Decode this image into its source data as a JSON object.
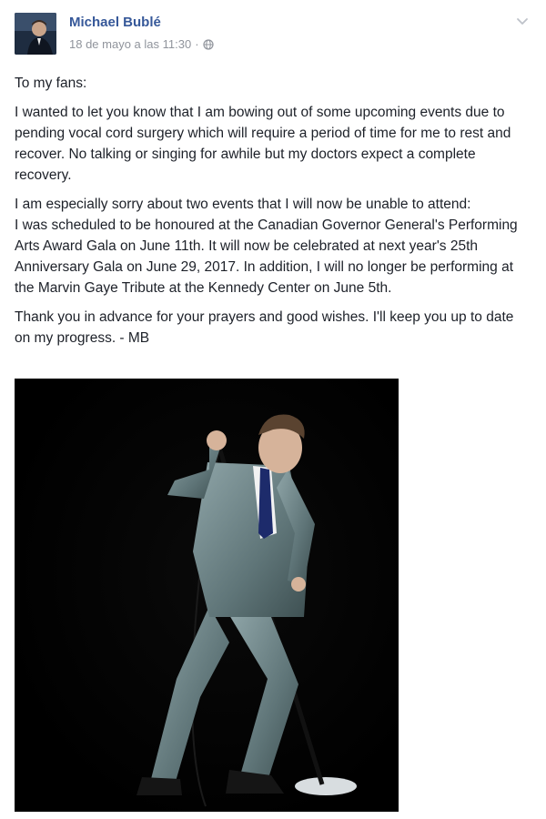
{
  "post": {
    "author": "Michael Bublé",
    "timestamp": "18 de mayo a las 11:30",
    "separator": "·",
    "privacy_icon": "globe-icon",
    "menu_icon": "chevron-down-icon",
    "paragraphs": [
      "To my fans:",
      "I wanted to let you know that I am bowing out of some upcoming events due to pending vocal cord surgery which will require a period of time for me to rest and recover. No talking or singing for awhile but my doctors expect a complete recovery.",
      "I am especially sorry about two events that I will now be unable to attend:\nI was scheduled to be honoured at the Canadian Governor General's Performing Arts Award Gala on June 11th. It will now be celebrated at next year's 25th Anniversary Gala on June 29, 2017. In addition, I will no longer be performing at the Marvin Gaye Tribute at the Kennedy Center on June 5th.",
      "Thank you in advance for your prayers and good wishes. I'll keep you up to date on my progress. - MB"
    ]
  },
  "colors": {
    "author_link": "#365899",
    "meta_text": "#90949c",
    "body_text": "#1d2129",
    "photo_background": "#000000"
  }
}
